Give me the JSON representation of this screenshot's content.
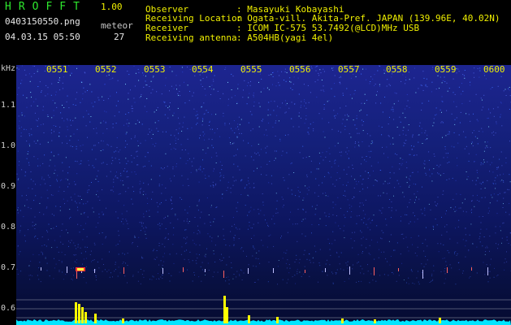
{
  "header": {
    "app_name": "HROFFT",
    "version": "1.00",
    "filename": "0403150550.png",
    "timestamp": "04.03.15 05:50",
    "meteor_label": "meteor",
    "meteor_count": "27",
    "info": [
      {
        "key": "Observer",
        "value": ": Masayuki Kobayashi"
      },
      {
        "key": "Receiving Location",
        "value": ": Ogata-vill. Akita-Pref. JAPAN (139.96E, 40.02N)"
      },
      {
        "key": "Receiver",
        "value": ": ICOM IC-575 53.7492(@LCD)MHz USB"
      },
      {
        "key": "Receiving antenna",
        "value": ": A504HB(yagi 4el)"
      }
    ]
  },
  "axis": {
    "y_unit": "kHz",
    "y_ticks": [
      "1.1",
      "1.0",
      "0.9",
      "0.8",
      "0.7",
      "0.6"
    ],
    "x_ticks": [
      "0551",
      "0552",
      "0553",
      "0554",
      "0555",
      "0556",
      "0557",
      "0558",
      "0559",
      "0600"
    ]
  },
  "colors": {
    "background": "#000000",
    "title_green": "#2ee82e",
    "label_yellow": "#f0f000",
    "spectrum_blue": "#1d2590",
    "noise_cyan": "#00e5ff",
    "peak_yellow": "#ffff00"
  }
}
